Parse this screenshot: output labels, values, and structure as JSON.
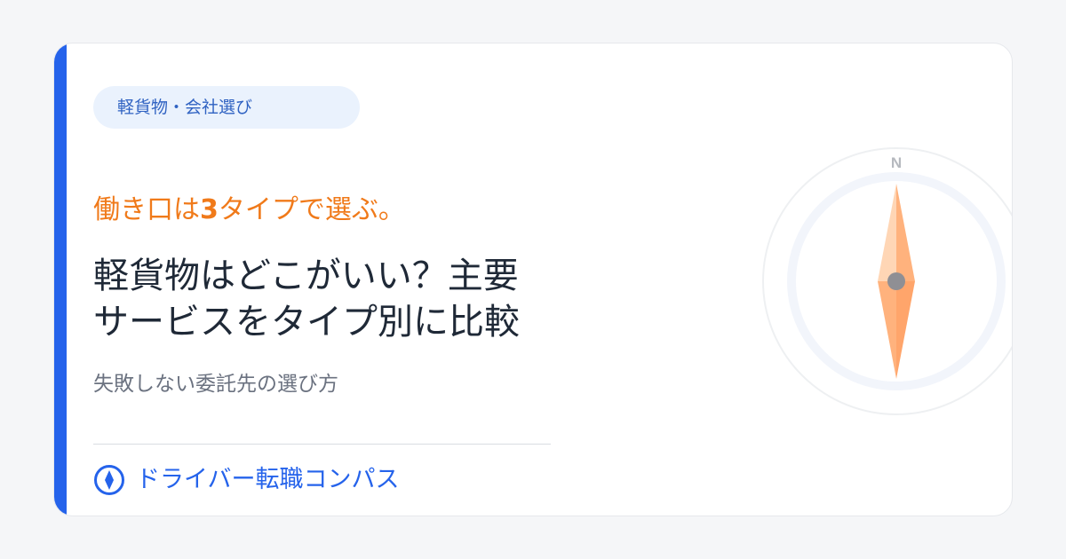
{
  "tag": {
    "label": "軽貨物・会社選び"
  },
  "eyebrow": {
    "prefix": "働き口は",
    "highlight": "3",
    "suffix": "タイプで選ぶ。"
  },
  "headline": {
    "line1": "軽貨物はどこがいい？主要",
    "line2": "サービスをタイプ別に比較"
  },
  "subtitle": "失敗しない委託先の選び方",
  "brand": {
    "name": "ドライバー転職コンパス",
    "icon": "compass-diamond-icon"
  },
  "compass": {
    "north_label": "N",
    "icon": "compass-icon"
  },
  "colors": {
    "accent": "#2563eb",
    "orange": "#f07a1a",
    "tag_bg": "#eaf2fd",
    "needle": "#ffb27d"
  }
}
